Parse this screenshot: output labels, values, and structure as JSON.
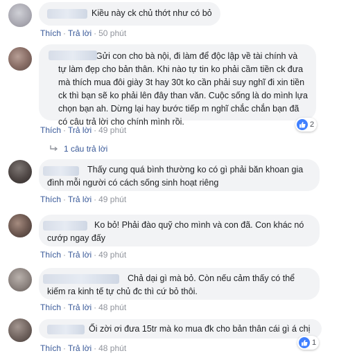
{
  "labels": {
    "like": "Thích",
    "reply": "Trả lời",
    "separator": "·"
  },
  "colors": {
    "bubble_bg": "#f2f3f5",
    "link": "#385898",
    "timestamp": "#90949c",
    "like_icon": "#4080ff"
  },
  "comments": [
    {
      "text": "Kiều này ck chủ thớt như có bỏ",
      "time": "50 phút"
    },
    {
      "text": "Gửi con cho bà nội, đi làm để độc lập về tài chính và tự làm đẹp cho bản thân. Khi nào tự tin ko phải cầm tiền ck đưa mà thích mua đôi giày 3t hay 30t ko cần phải suy nghĩ đi xin tiền ck thì bạn sẽ ko phải lên đây than văn. Cuộc sống là do mình lựa chọn bạn ah. Dừng lại hay bước tiếp m nghĩ chắc chắn bạn đã có câu trả lời cho chính mình rồi.",
      "time": "49 phút",
      "reaction_count": "2",
      "replies_label": "1 câu trả lời"
    },
    {
      "text": "Thấy cung quá bình thường ko có gì phải băn khoan gia đình mỗi người có cách sống sinh hoạt riêng",
      "time": "49 phút"
    },
    {
      "text": "Ko bỏ! Phải đào quỹ cho mình và con đã. Con khác nó cướp ngay đấy",
      "time": "49 phút"
    },
    {
      "text": "Chả dại gì mà bỏ. Còn nếu cảm thấy có thể kiếm ra kinh tế tự chủ đc thì cứ bỏ thôi.",
      "time": "48 phút"
    },
    {
      "text": "Ối zời ơi đưa 15tr mà ko mua đk cho bản thân cái gì á chị",
      "time": "48 phút",
      "reaction_count": "1"
    }
  ]
}
